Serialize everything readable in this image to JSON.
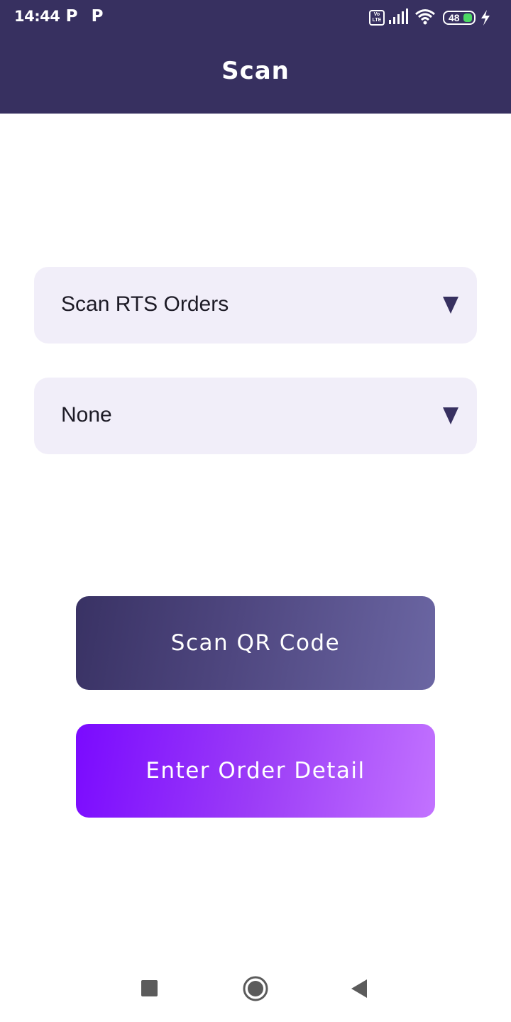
{
  "status_bar": {
    "time": "14:44",
    "notification_icons": [
      "P",
      "P"
    ],
    "network_label": "Vo LTE",
    "battery_level": "48",
    "battery_percent": 48,
    "charging": true
  },
  "app_bar": {
    "title": "Scan"
  },
  "form": {
    "order_type": {
      "selected": "Scan RTS Orders"
    },
    "secondary_option": {
      "selected": "None"
    }
  },
  "actions": {
    "scan_qr_label": "Scan QR Code",
    "enter_detail_label": "Enter Order Detail"
  },
  "colors": {
    "primary": "#373060",
    "accent": "#7a0aff",
    "field_background": "#f1eef9"
  },
  "nav_bar": {
    "icons": [
      "recents-icon",
      "home-icon",
      "back-icon"
    ]
  }
}
